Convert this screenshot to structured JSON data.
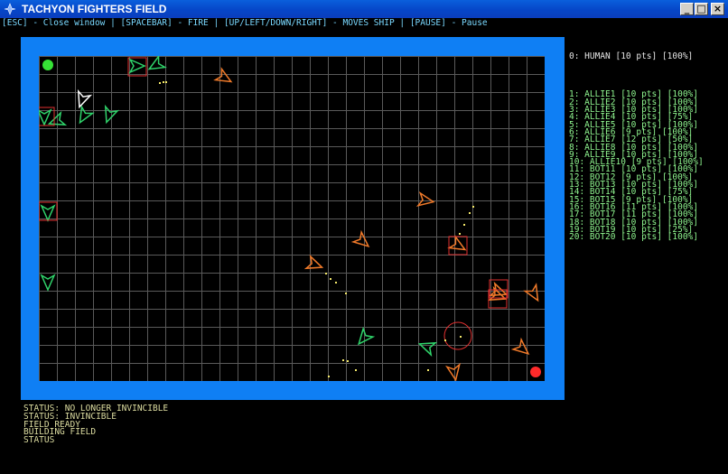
{
  "window": {
    "title": "TACHYON FIGHTERS FIELD",
    "minimize_label": "_",
    "maximize_label": "□",
    "close_label": "×"
  },
  "help_text": "[ESC] - Close window | [SPACEBAR] - FIRE | [UP/LEFT/DOWN/RIGHT] - MOVES SHIP | [PAUSE] - Pause",
  "players": {
    "human": "0: HUMAN [10 pts] [100%]",
    "list": [
      "1: ALLIE1 [10 pts] [100%]",
      "2: ALLIE2 [10 pts] [100%]",
      "3: ALLIE3 [10 pts] [100%]",
      "4: ALLIE4 [10 pts] [75%]",
      "5: ALLIE5 [10 pts] [100%]",
      "6: ALLIE6 [9 pts] [100%]",
      "7: ALLIE7 [12 pts] [50%]",
      "8: ALLIE8 [10 pts] [100%]",
      "9: ALLIE9 [10 pts] [100%]",
      "10: ALLIE10 [9 pts] [100%]",
      "11: BOT11 [10 pts] [100%]",
      "12: BOT12 [9 pts] [100%]",
      "13: BOT13 [10 pts] [100%]",
      "14: BOT14 [10 pts] [75%]",
      "15: BOT15 [9 pts] [100%]",
      "16: BOT16 [11 pts] [100%]",
      "17: BOT17 [11 pts] [100%]",
      "18: BOT18 [10 pts] [100%]",
      "19: BOT19 [10 pts] [25%]",
      "20: BOT20 [10 pts] [100%]"
    ]
  },
  "status_log": [
    "STATUS: NO LONGER INVINCIBLE",
    "STATUS: INVINCIBLE",
    "FIELD READY",
    "BUILDING FIELD",
    "STATUS"
  ],
  "colors": {
    "arena_border": "#0f7ff4",
    "grid_line": "#5a5a5a",
    "ally_ship": "#2fd36a",
    "enemy_ship": "#f07a2a",
    "human_ship": "#ffffff",
    "target_box": "#e03030",
    "ally_base": "#36e236",
    "enemy_base": "#ff2a2a",
    "bullet": "#f4e96a"
  },
  "icons": {
    "app": "fighter-app-icon",
    "ally_ship": "ally-fighter-icon",
    "enemy_ship": "enemy-fighter-icon",
    "human_ship": "human-fighter-icon",
    "ally_base": "ally-base-marker",
    "enemy_base": "enemy-base-marker"
  }
}
